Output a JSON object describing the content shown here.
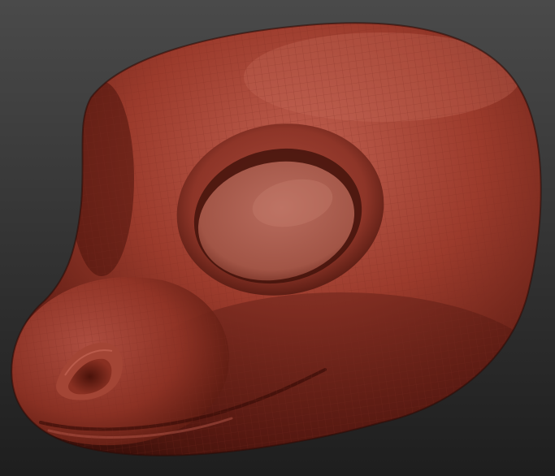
{
  "scene": {
    "subject": "sculpted-head-model",
    "colors": {
      "background_top": "#4a4a4a",
      "background_bottom": "#1e1e1e",
      "clay_light": "#c06050",
      "clay_mid": "#9c3b2c",
      "clay_dark": "#5e1c13",
      "clay_shadow": "#3d100a",
      "wireframe": "#7a2a1e"
    }
  }
}
